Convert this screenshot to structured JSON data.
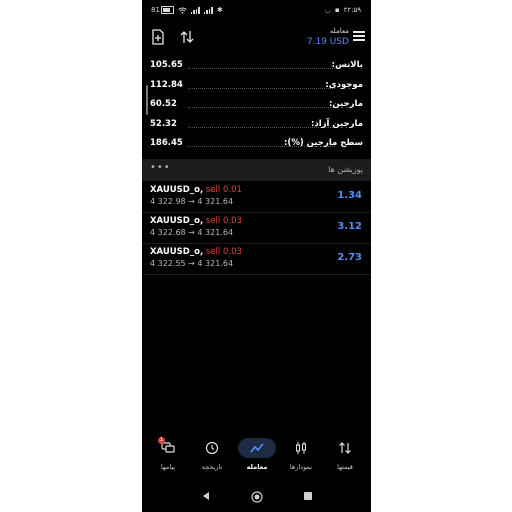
{
  "status_bar": {
    "battery": "81",
    "time": "۲۲:۵۹"
  },
  "header": {
    "title": "معامله",
    "balance": "7.19 USD"
  },
  "metrics": [
    {
      "label": "بالانس:",
      "value": "105.65"
    },
    {
      "label": "موجودی:",
      "value": "112.84"
    },
    {
      "label": "مارجین:",
      "value": "60.52"
    },
    {
      "label": "مارجین آزاد:",
      "value": "52.32"
    },
    {
      "label": "سطح مارجین (%):",
      "value": "186.45"
    }
  ],
  "positions": {
    "title": "پوزیشن ها",
    "more": "•••",
    "items": [
      {
        "symbol": "XAUUSD_o,",
        "side": "sell 0.01",
        "prices": "4 322.98 → 4 321.64",
        "profit": "1.34"
      },
      {
        "symbol": "XAUUSD_o,",
        "side": "sell 0.03",
        "prices": "4 322.68 → 4 321.64",
        "profit": "3.12"
      },
      {
        "symbol": "XAUUSD_o,",
        "side": "sell 0.03",
        "prices": "4 322.55 → 4 321.64",
        "profit": "2.73"
      }
    ]
  },
  "bottom_nav": {
    "messages": {
      "label": "پیامها",
      "badge": "1",
      "icon": "chat-bubbles-icon"
    },
    "history": {
      "label": "تاریخچه",
      "icon": "history-icon"
    },
    "trade": {
      "label": "معامله",
      "icon": "trade-icon"
    },
    "charts": {
      "label": "نمودارها",
      "icon": "candlestick-icon"
    },
    "quotes": {
      "label": "قیمتها",
      "icon": "quotes-arrows-icon"
    }
  },
  "colors": {
    "background": "#000000",
    "accent_blue": "#4f8ef7",
    "sell_red": "#e0443a",
    "section_bg": "#1c1c1e"
  }
}
